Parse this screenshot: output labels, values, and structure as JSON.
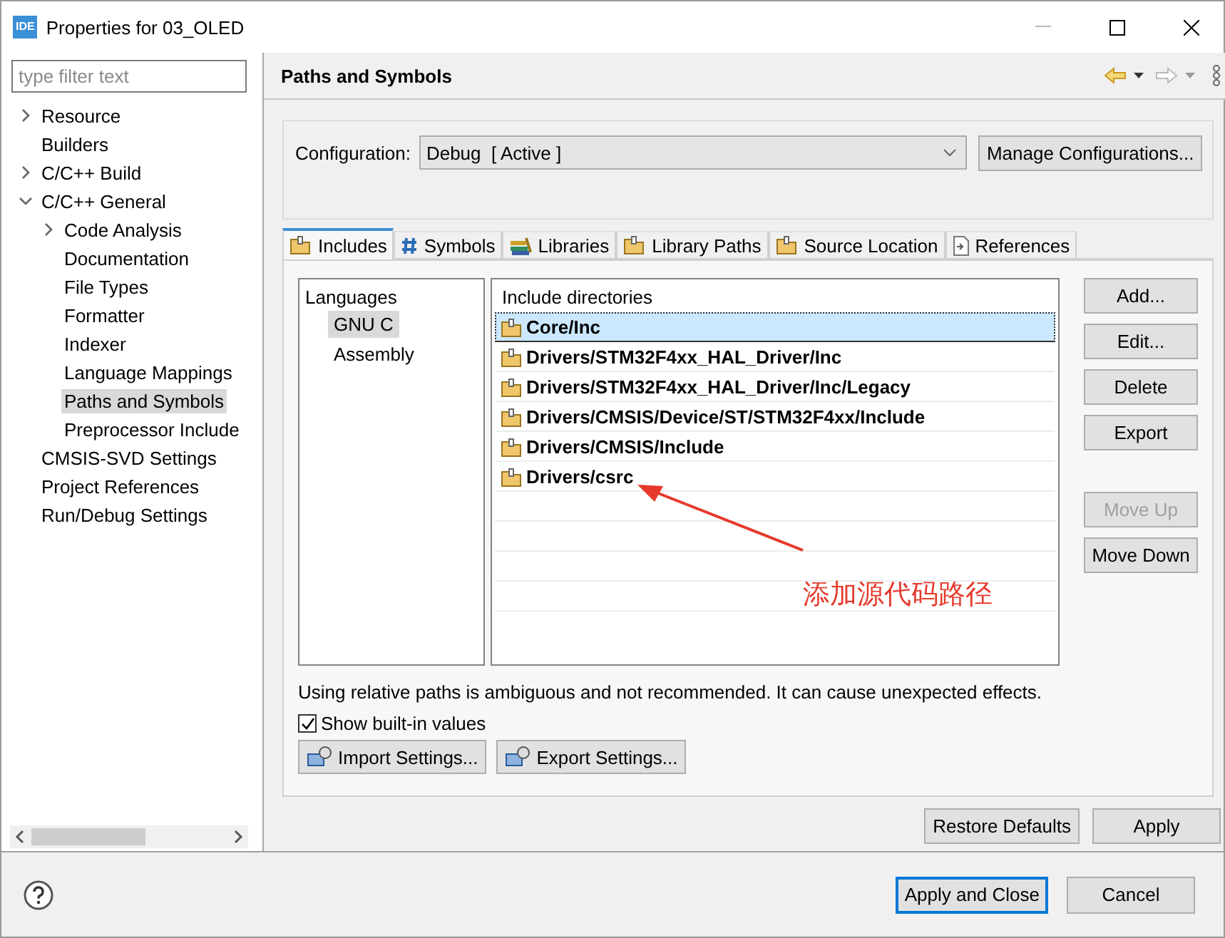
{
  "window": {
    "title": "Properties for 03_OLED",
    "app_badge": "IDE"
  },
  "filter": {
    "placeholder": "type filter text"
  },
  "tree": [
    {
      "label": "Resource",
      "kind": "branch",
      "expanded": false,
      "selected": false
    },
    {
      "label": "Builders",
      "kind": "leaf",
      "selected": false
    },
    {
      "label": "C/C++ Build",
      "kind": "branch",
      "expanded": false,
      "selected": false
    },
    {
      "label": "C/C++ General",
      "kind": "branch",
      "expanded": true,
      "selected": false,
      "children": [
        {
          "label": "Code Analysis",
          "kind": "branch",
          "expanded": false,
          "selected": false
        },
        {
          "label": "Documentation",
          "kind": "leaf",
          "selected": false
        },
        {
          "label": "File Types",
          "kind": "leaf",
          "selected": false
        },
        {
          "label": "Formatter",
          "kind": "leaf",
          "selected": false
        },
        {
          "label": "Indexer",
          "kind": "leaf",
          "selected": false
        },
        {
          "label": "Language Mappings",
          "kind": "leaf",
          "selected": false
        },
        {
          "label": "Paths and Symbols",
          "kind": "leaf",
          "selected": true
        },
        {
          "label": "Preprocessor Include",
          "kind": "leaf",
          "selected": false
        }
      ]
    },
    {
      "label": "CMSIS-SVD Settings",
      "kind": "leaf",
      "selected": false
    },
    {
      "label": "Project References",
      "kind": "leaf",
      "selected": false
    },
    {
      "label": "Run/Debug Settings",
      "kind": "leaf",
      "selected": false
    }
  ],
  "page_title": "Paths and Symbols",
  "configuration": {
    "label": "Configuration:",
    "value": "Debug  [ Active ]",
    "manage_button": "Manage Configurations..."
  },
  "tabs": [
    {
      "label": "Includes",
      "selected": true
    },
    {
      "label": "Symbols",
      "selected": false
    },
    {
      "label": "Libraries",
      "selected": false
    },
    {
      "label": "Library Paths",
      "selected": false
    },
    {
      "label": "Source Location",
      "selected": false
    },
    {
      "label": "References",
      "selected": false
    }
  ],
  "languages": {
    "heading": "Languages",
    "items": [
      {
        "label": "GNU C",
        "selected": true
      },
      {
        "label": "Assembly",
        "selected": false
      }
    ]
  },
  "include_directories": {
    "heading": "Include directories",
    "items": [
      {
        "path": "Core/Inc",
        "selected": true
      },
      {
        "path": "Drivers/STM32F4xx_HAL_Driver/Inc",
        "selected": false
      },
      {
        "path": "Drivers/STM32F4xx_HAL_Driver/Inc/Legacy",
        "selected": false
      },
      {
        "path": "Drivers/CMSIS/Device/ST/STM32F4xx/Include",
        "selected": false
      },
      {
        "path": "Drivers/CMSIS/Include",
        "selected": false
      },
      {
        "path": "Drivers/csrc",
        "selected": false
      }
    ]
  },
  "side_buttons": [
    {
      "label": "Add...",
      "disabled": false
    },
    {
      "label": "Edit...",
      "disabled": false
    },
    {
      "label": "Delete",
      "disabled": false
    },
    {
      "label": "Export",
      "disabled": false
    },
    {
      "label": "Move Up",
      "disabled": true
    },
    {
      "label": "Move Down",
      "disabled": false
    }
  ],
  "annotation": {
    "text": "添加源代码路径"
  },
  "warning": "Using relative paths is ambiguous and not recommended. It can cause unexpected effects.",
  "show_builtin": {
    "label": "Show built-in values",
    "checked": true
  },
  "settings_buttons": [
    "Import Settings...",
    "Export Settings..."
  ],
  "page_buttons": [
    "Restore Defaults",
    "Apply"
  ],
  "dialog_buttons": [
    {
      "label": "Apply and Close",
      "default": true
    },
    {
      "label": "Cancel",
      "default": false
    }
  ]
}
